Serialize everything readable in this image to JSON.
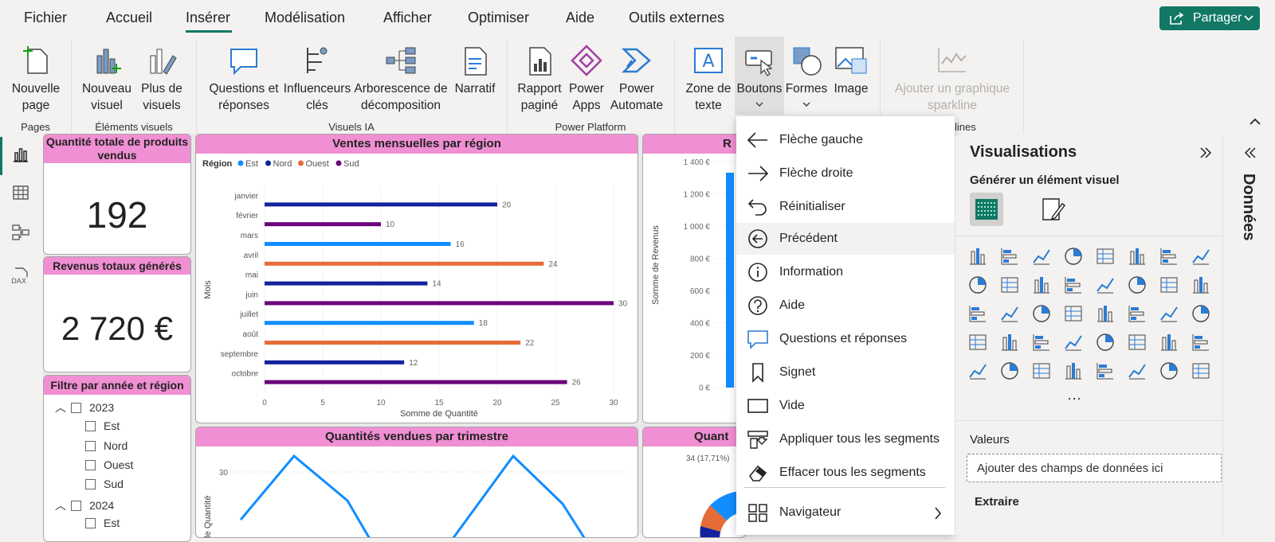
{
  "menu": {
    "items": [
      "Fichier",
      "Accueil",
      "Insérer",
      "Modélisation",
      "Afficher",
      "Optimiser",
      "Aide",
      "Outils externes"
    ],
    "active": "Insérer",
    "share_label": "Partager"
  },
  "ribbon": {
    "new_page": "Nouvelle page",
    "new_visual": "Nouveau visuel",
    "more_visuals": "Plus de visuels",
    "qna": "Questions et réponses",
    "influencers": "Influenceurs clés",
    "decomp": "Arborescence de décomposition",
    "narrative": "Narratif",
    "paginated": "Rapport paginé",
    "power_apps": "Power Apps",
    "power_automate": "Power Automate",
    "textbox": "Zone de texte",
    "buttons": "Boutons",
    "shapes": "Formes",
    "image": "Image",
    "sparkline": "Ajouter un graphique sparkline",
    "groups": {
      "pages": "Pages",
      "visual_elements": "Éléments visuels",
      "ai": "Visuels IA",
      "power_platform": "Power Platform",
      "sparklines_tail": "lines"
    }
  },
  "cards": {
    "qty_title": "Quantité totale de produits vendus",
    "qty_value": "192",
    "rev_title": "Revenus totaux générés",
    "rev_value": "2 720 €",
    "slicer_title": "Filtre par année et région",
    "slicer_items": [
      "2023",
      "Est",
      "Nord",
      "Ouest",
      "Sud",
      "2024",
      "Est"
    ]
  },
  "bar_chart": {
    "title": "Ventes mensuelles par région",
    "legend_title": "Région",
    "xlabel": "Somme de Quantité",
    "ylabel": "Mois"
  },
  "right_chart": {
    "title_partial": "R",
    "ylabel": "Somme de Revenus",
    "ticks": [
      "1 400 €",
      "1 200 €",
      "1 000 €",
      "800 €",
      "600 €",
      "400 €",
      "200 €",
      "0 €"
    ]
  },
  "line_chart": {
    "title": "Quantités vendues par trimestre",
    "ylabel_partial": "de Quantité",
    "tick": "30"
  },
  "pie_chart": {
    "title_partial": "Quant",
    "label": "34 (17,71%)"
  },
  "chart_data": [
    {
      "type": "bar",
      "title": "Ventes mensuelles par région",
      "xlabel": "Somme de Quantité",
      "ylabel": "Mois",
      "xlim": [
        0,
        30
      ],
      "xticks": [
        0,
        5,
        10,
        15,
        20,
        25,
        30
      ],
      "legend": [
        {
          "name": "Est",
          "color": "#118dff"
        },
        {
          "name": "Nord",
          "color": "#12239e"
        },
        {
          "name": "Ouest",
          "color": "#e66c37"
        },
        {
          "name": "Sud",
          "color": "#6b007b"
        }
      ],
      "categories": [
        "janvier",
        "février",
        "mars",
        "avril",
        "mai",
        "juin",
        "juillet",
        "août",
        "septembre",
        "octobre"
      ],
      "bars": [
        {
          "month": "janvier",
          "region": "Nord",
          "value": 20
        },
        {
          "month": "février",
          "region": "Sud",
          "value": 10
        },
        {
          "month": "mars",
          "region": "Est",
          "value": 16
        },
        {
          "month": "avril",
          "region": "Ouest",
          "value": 24
        },
        {
          "month": "mai",
          "region": "Nord",
          "value": 14
        },
        {
          "month": "juin",
          "region": "Sud",
          "value": 30
        },
        {
          "month": "juillet",
          "region": "Est",
          "value": 18
        },
        {
          "month": "août",
          "region": "Ouest",
          "value": 22
        },
        {
          "month": "septembre",
          "region": "Nord",
          "value": 12
        },
        {
          "month": "octobre",
          "region": "Sud",
          "value": 26
        }
      ]
    }
  ],
  "dropdown": {
    "items": [
      {
        "label": "Flèche gauche",
        "icon": "arrow-left-icon"
      },
      {
        "label": "Flèche droite",
        "icon": "arrow-right-icon"
      },
      {
        "label": "Réinitialiser",
        "icon": "reset-icon"
      },
      {
        "label": "Précédent",
        "icon": "back-circle-icon"
      },
      {
        "label": "Information",
        "icon": "info-icon"
      },
      {
        "label": "Aide",
        "icon": "help-icon"
      },
      {
        "label": "Questions et réponses",
        "icon": "qna-bubble-icon"
      },
      {
        "label": "Signet",
        "icon": "bookmark-icon"
      },
      {
        "label": "Vide",
        "icon": "blank-icon"
      },
      {
        "label": "Appliquer tous les segments",
        "icon": "apply-slicers-icon"
      },
      {
        "label": "Effacer tous les segments",
        "icon": "eraser-icon"
      },
      {
        "label": "Navigateur",
        "icon": "navigator-icon"
      }
    ],
    "highlighted": "Précédent"
  },
  "viz_panel": {
    "title": "Visualisations",
    "build_label": "Générer un élément visuel",
    "values_label": "Valeurs",
    "values_placeholder": "Ajouter des champs de données ici",
    "extract_label": "Extraire",
    "more": "···"
  },
  "data_panel": {
    "title": "Données"
  }
}
